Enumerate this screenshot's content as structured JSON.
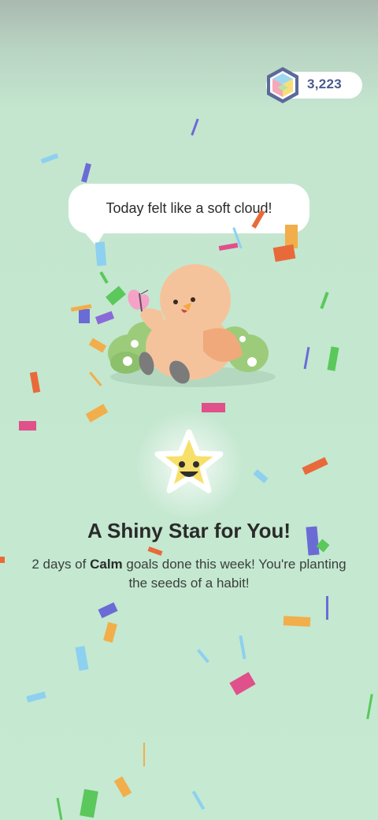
{
  "gems": {
    "count": "3,223",
    "icon": "gem-icon"
  },
  "speech_bubble": {
    "text": "Today felt like a soft cloud!"
  },
  "reward": {
    "title": "A Shiny Star for You!",
    "message_prefix": "2 days of ",
    "message_goal": "Calm",
    "message_suffix": " goals done this week! You're planting the seeds of a habit!",
    "icon": "smiling-star-icon"
  },
  "colors": {
    "background": "#c5e9d1",
    "gem_count": "#4a5a8e",
    "star": "#f7e06a",
    "bird": "#f5c39b"
  }
}
